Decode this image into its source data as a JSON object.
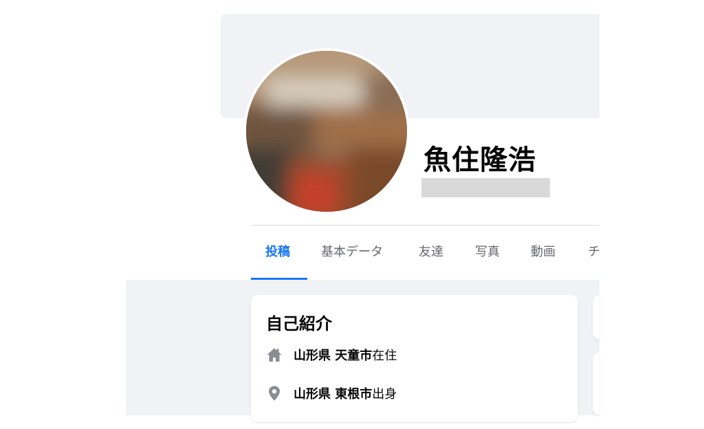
{
  "profile": {
    "name": "魚住隆浩"
  },
  "tabs": [
    {
      "label": "投稿",
      "active": true
    },
    {
      "label": "基本データ",
      "active": false
    },
    {
      "label": "友達",
      "active": false
    },
    {
      "label": "写真",
      "active": false
    },
    {
      "label": "動画",
      "active": false
    },
    {
      "label": "チ",
      "active": false
    }
  ],
  "intro": {
    "title": "自己紹介",
    "items": [
      {
        "icon": "home-icon",
        "place": "山形県 天童市",
        "suffix": "在住"
      },
      {
        "icon": "location-pin-icon",
        "place": "山形県 東根市",
        "suffix": "出身"
      }
    ]
  },
  "colors": {
    "accent": "#1877f2",
    "page_bg": "#f0f2f5",
    "muted_text": "#65676b",
    "icon_gray": "#8a8d91"
  }
}
